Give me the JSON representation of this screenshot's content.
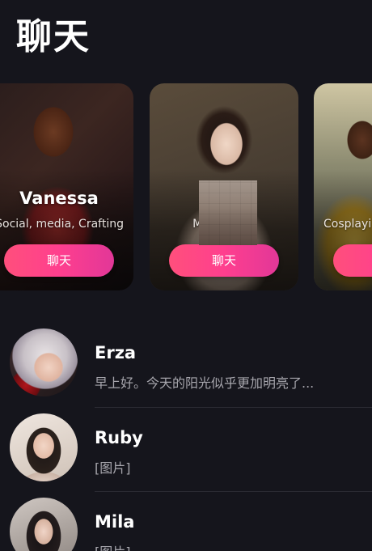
{
  "header": {
    "title": "聊天"
  },
  "featured": [
    {
      "name": "Vanessa",
      "tags": "Social, media, Crafting",
      "button_label": "聊天"
    },
    {
      "name": "",
      "tags": "Matu            Asian",
      "button_label": "聊天"
    },
    {
      "name": "",
      "tags": "Cosplayi",
      "button_label": ""
    }
  ],
  "conversations": [
    {
      "name": "Erza",
      "preview": "早上好。今天的阳光似乎更加明亮了..."
    },
    {
      "name": "Ruby",
      "preview": "[图片]"
    },
    {
      "name": "Mila",
      "preview": "[图片]"
    }
  ],
  "colors": {
    "background": "#15151c",
    "accent_start": "#ff4f7c",
    "accent_end": "#e23798",
    "preview_text": "#a7a6ad",
    "divider": "#2b2b33"
  }
}
